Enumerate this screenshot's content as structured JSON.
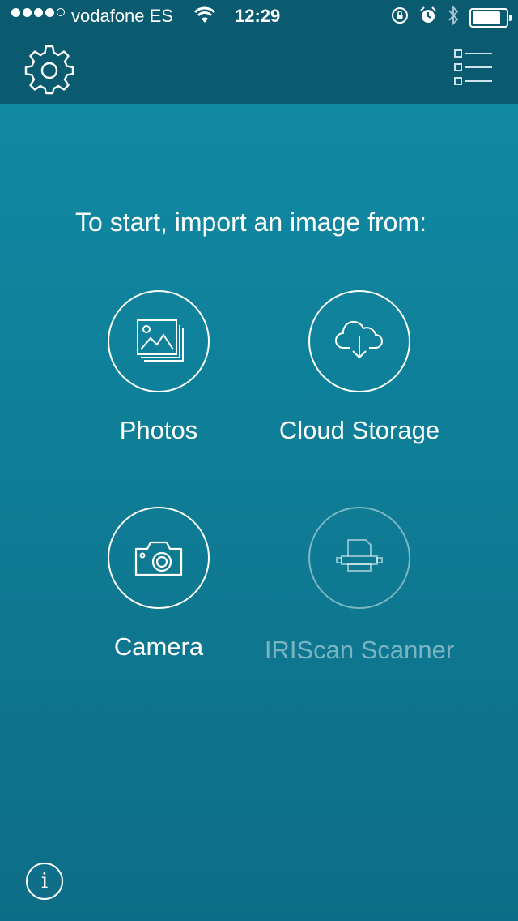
{
  "status_bar": {
    "carrier": "vodafone ES",
    "time": "12:29",
    "signal_bars": 4,
    "signal_total": 5
  },
  "nav": {
    "settings_icon": "gear-icon",
    "list_icon": "checklist-icon"
  },
  "main": {
    "instruction": "To start, import an image from:",
    "options": [
      {
        "label": "Photos",
        "icon": "photos-icon",
        "enabled": true
      },
      {
        "label": "Cloud Storage",
        "icon": "cloud-download-icon",
        "enabled": true
      },
      {
        "label": "Camera",
        "icon": "camera-icon",
        "enabled": true
      },
      {
        "label": "IRIScan Scanner",
        "icon": "scanner-icon",
        "enabled": false
      }
    ]
  },
  "footer": {
    "info_glyph": "i"
  },
  "colors": {
    "header_bg": "#0b5b70",
    "body_top": "#118ca7",
    "body_bottom": "#0e6d86",
    "foreground": "#ffffff"
  }
}
